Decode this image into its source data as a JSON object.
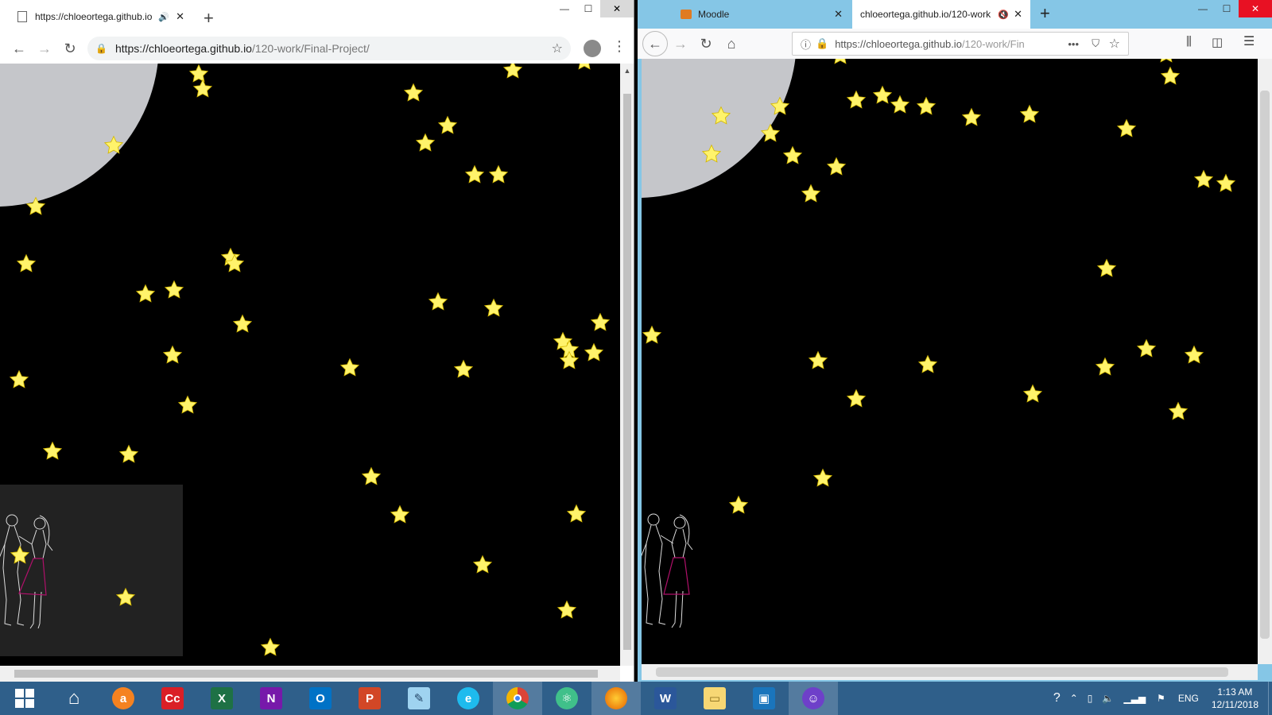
{
  "chrome": {
    "tab_title": "https://chloeortega.github.io",
    "url_host": "https://chloeortega.github.io",
    "url_path": "/120-work/Final-Project/"
  },
  "firefox": {
    "tab1_title": "Moodle",
    "tab2_title": "chloeortega.github.io/120-work",
    "url_host": "https://chloeortega.github.io",
    "url_path": "/120-work/Fin"
  },
  "taskbar": {
    "items": [
      "start",
      "home",
      "avast",
      "adobe-cc",
      "excel",
      "onenote",
      "outlook",
      "powerpoint",
      "notepad",
      "internet-explorer",
      "chrome",
      "atom",
      "firefox",
      "word",
      "file-explorer",
      "virtualbox",
      "github-desktop"
    ],
    "language": "ENG",
    "time": "1:13 AM",
    "date": "12/11/2018"
  },
  "colors": {
    "star_fill": "#fff36b",
    "star_stroke": "#d4b800",
    "moon": "#c5c6ca",
    "canvas_bg": "#000000",
    "taskbar": "#2f5f8a"
  }
}
